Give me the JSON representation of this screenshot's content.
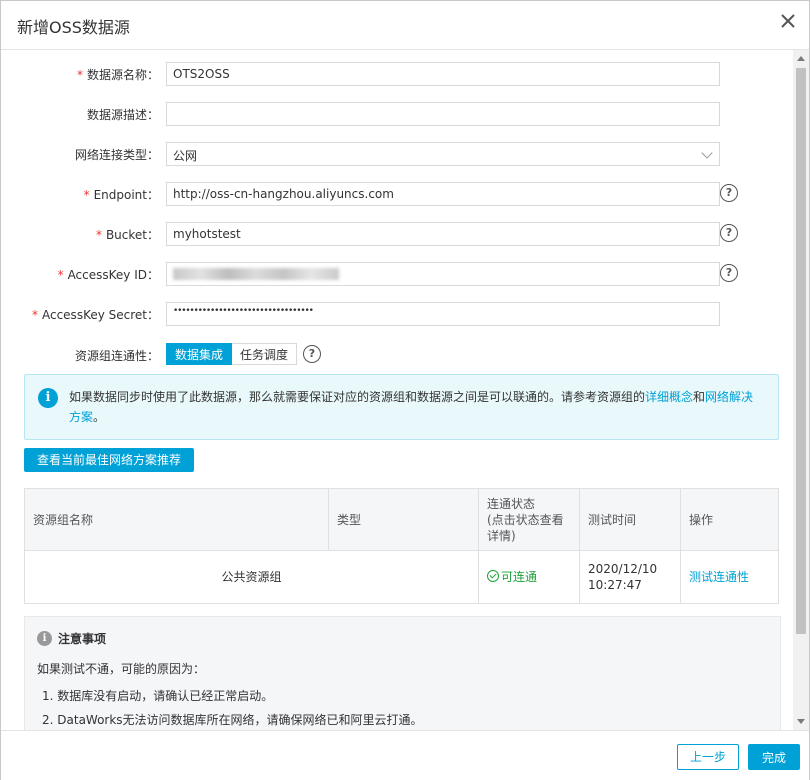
{
  "dialog": {
    "title": "新增OSS数据源"
  },
  "form": {
    "name": {
      "label": "数据源名称：",
      "value": "OTS2OSS",
      "required": true
    },
    "desc": {
      "label": "数据源描述：",
      "value": ""
    },
    "network": {
      "label": "网络连接类型：",
      "value": "公网"
    },
    "endpoint": {
      "label": "Endpoint：",
      "value": "http://oss-cn-hangzhou.aliyuncs.com",
      "required": true
    },
    "bucket": {
      "label": "Bucket：",
      "value": "myhotstest",
      "required": true
    },
    "access_key_id": {
      "label": "AccessKey ID：",
      "value": "(redacted)",
      "required": true
    },
    "access_key_secret": {
      "label": "AccessKey Secret：",
      "value": "••••••••••••••••••••••••••••••••••",
      "required": true
    },
    "resource_group": {
      "label": "资源组连通性：",
      "options": [
        "数据集成",
        "任务调度"
      ],
      "selected": "数据集成"
    },
    "required_mark": "*",
    "help_glyph": "?"
  },
  "notice": {
    "text_before": "如果数据同步时使用了此数据源，那么就需要保证对应的资源组和数据源之间是可以联通的。请参考资源组的",
    "link1": "详细概念",
    "and": "和",
    "link2": "网络解决方案",
    "end": "。"
  },
  "recommend_button": "查看当前最佳网络方案推荐",
  "table": {
    "headers": [
      "资源组名称",
      "类型",
      "连通状态\n(点击状态查看\n详情)",
      "测试时间",
      "操作"
    ],
    "rows": [
      {
        "name": "公共资源组",
        "type": "",
        "status": "可连通",
        "time": "2020/12/10\n10:27:47",
        "action": "测试连通性"
      }
    ]
  },
  "note": {
    "title": "注意事项",
    "intro": "如果测试不通，可能的原因为：",
    "items": [
      "1.  数据库没有启动，请确认已经正常启动。",
      "2.  DataWorks无法访问数据库所在网络，请确保网络已和阿里云打通。"
    ]
  },
  "footer": {
    "prev": "上一步",
    "done": "完成"
  },
  "colors": {
    "primary": "#00a1d6",
    "success": "#1fa03a",
    "required": "#e33"
  }
}
